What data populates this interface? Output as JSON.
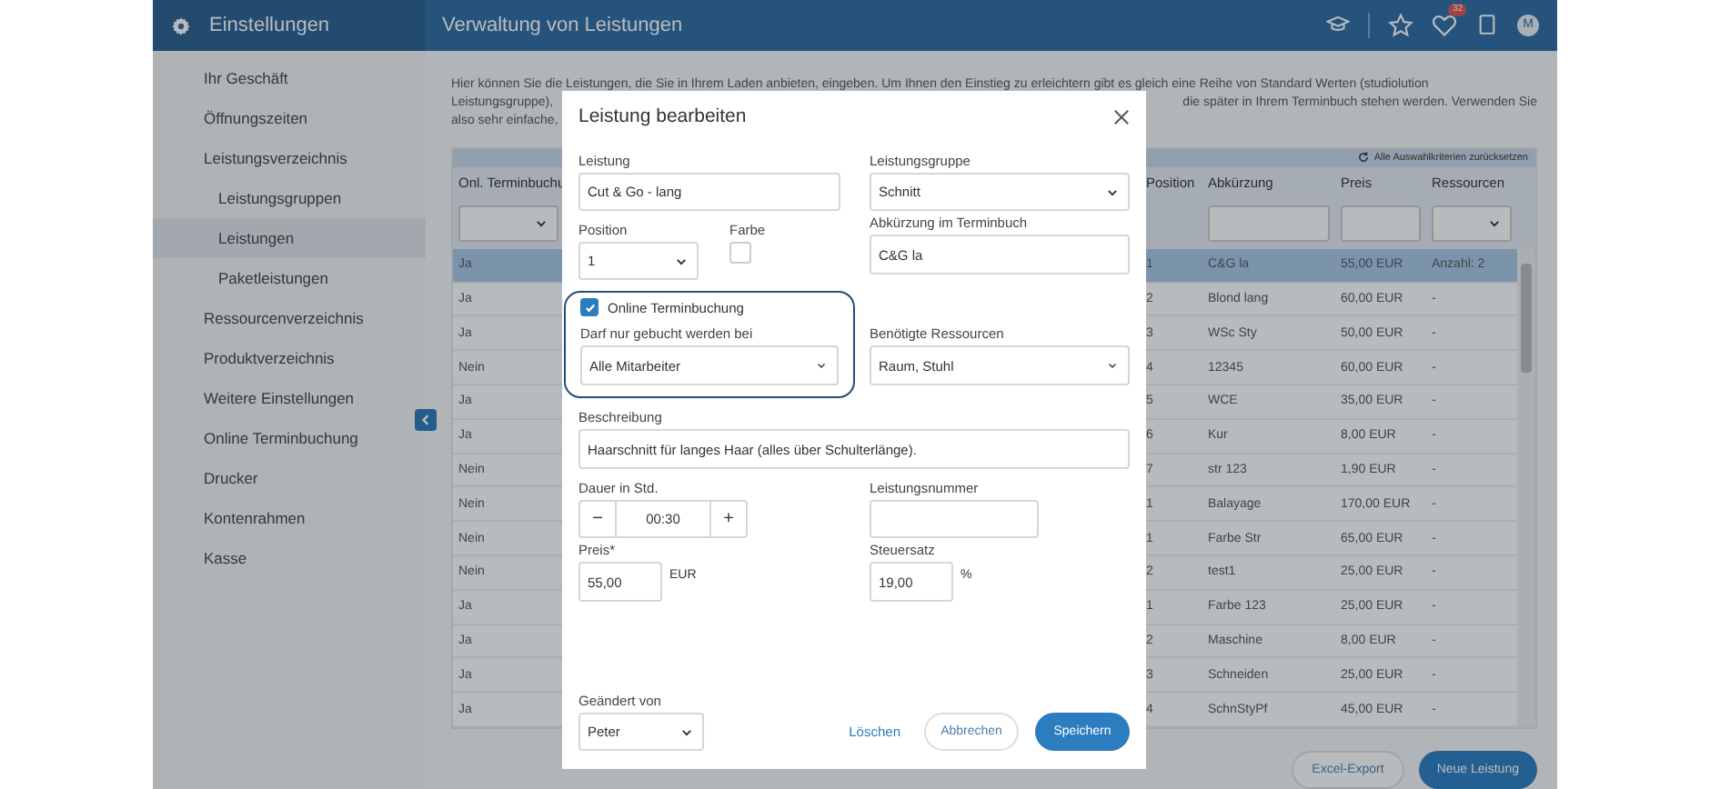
{
  "sidebar": {
    "title": "Einstellungen",
    "items": [
      {
        "label": "Ihr Geschäft",
        "selected": false
      },
      {
        "label": "Öffnungszeiten",
        "selected": false
      },
      {
        "label": "Leistungsverzeichnis",
        "selected": false,
        "children": [
          {
            "label": "Leistungsgruppen",
            "selected": false
          },
          {
            "label": "Leistungen",
            "selected": true
          },
          {
            "label": "Paketleistungen",
            "selected": false
          }
        ]
      },
      {
        "label": "Ressourcenverzeichnis",
        "selected": false
      },
      {
        "label": "Produktverzeichnis",
        "selected": false
      },
      {
        "label": "Weitere Einstellungen",
        "selected": false
      },
      {
        "label": "Online Terminbuchung",
        "selected": false
      },
      {
        "label": "Drucker",
        "selected": false
      },
      {
        "label": "Kontenrahmen",
        "selected": false
      },
      {
        "label": "Kasse",
        "selected": false
      }
    ]
  },
  "header": {
    "title": "Verwaltung von Leistungen",
    "notification_count": "32",
    "avatar": "M"
  },
  "intro": [
    {
      "left": "Hier können Sie die Leistungen, die Sie in Ihrem Laden anbieten, eingeben. Um Ihnen den Einstieg zu erleichtern gibt es gleich eine Reihe von Standard Werten (studiolution"
    },
    {
      "left": "Leistungsgruppe),",
      "right": "die später in Ihrem Terminbuch stehen werden. Verwenden Sie"
    },
    {
      "left": "also sehr einfache,"
    }
  ],
  "table": {
    "reset_link": "Alle Auswahlkriterien zurücksetzen",
    "columns": [
      {
        "label": "Onl. Terminbuchu",
        "kind": "select"
      },
      {
        "label": "Position"
      },
      {
        "label": "Abkürzung",
        "kind": "input"
      },
      {
        "label": "Preis",
        "kind": "input"
      },
      {
        "label": "Ressourcen",
        "kind": "select"
      }
    ],
    "rows": [
      {
        "cells": [
          "Ja",
          "1",
          "C&G la",
          "55,00 EUR",
          "Anzahl: 2"
        ],
        "selected": true
      },
      {
        "cells": [
          "Ja",
          "2",
          "Blond lang",
          "60,00 EUR",
          "-"
        ],
        "selected": false
      },
      {
        "cells": [
          "Ja",
          "3",
          "WSc Sty",
          "50,00 EUR",
          "-"
        ],
        "selected": false
      },
      {
        "cells": [
          "Nein",
          "4",
          "12345",
          "60,00 EUR",
          "-"
        ],
        "selected": false
      },
      {
        "cells": [
          "Ja",
          "5",
          "WCE",
          "35,00 EUR",
          "-"
        ],
        "selected": false
      },
      {
        "cells": [
          "Ja",
          "6",
          "Kur",
          "8,00 EUR",
          "-"
        ],
        "selected": false
      },
      {
        "cells": [
          "Nein",
          "7",
          "str 123",
          "1,90 EUR",
          "-"
        ],
        "selected": false
      },
      {
        "cells": [
          "Nein",
          "1",
          "Balayage",
          "170,00 EUR",
          "-"
        ],
        "selected": false
      },
      {
        "cells": [
          "Nein",
          "1",
          "Farbe Str",
          "65,00 EUR",
          "-"
        ],
        "selected": false
      },
      {
        "cells": [
          "Nein",
          "2",
          "test1",
          "25,00 EUR",
          "-"
        ],
        "selected": false
      },
      {
        "cells": [
          "Ja",
          "1",
          "Farbe 123",
          "25,00 EUR",
          "-"
        ],
        "selected": false
      },
      {
        "cells": [
          "Ja",
          "2",
          "Maschine",
          "8,00 EUR",
          "-"
        ],
        "selected": false
      },
      {
        "cells": [
          "Ja",
          "3",
          "Schneiden",
          "25,00 EUR",
          "-"
        ],
        "selected": false
      },
      {
        "cells": [
          "Ja",
          "4",
          "SchnStyPf",
          "45,00 EUR",
          "-"
        ],
        "selected": false
      }
    ]
  },
  "buttons": [
    "Excel-Export",
    "Neue Leistung"
  ],
  "modal": {
    "title": "Leistung bearbeiten",
    "name": {
      "label": "Leistung",
      "value": "Cut & Go - lang"
    },
    "group": {
      "label": "Leistungsgruppe",
      "value": "Schnitt"
    },
    "position": {
      "label": "Position",
      "value": "1"
    },
    "color": {
      "label": "Farbe",
      "checked": false
    },
    "abbreviation": {
      "label": "Abkürzung im Terminbuch",
      "value": "C&G la"
    },
    "online": {
      "label": "Online Terminbuchung",
      "checked": true
    },
    "staff": {
      "label": "Darf nur gebucht werden bei",
      "value": "Alle Mitarbeiter"
    },
    "resources": {
      "label": "Benötigte Ressourcen",
      "value": "Raum, Stuhl"
    },
    "description": {
      "label": "Beschreibung",
      "value": "Haarschnitt für langes Haar (alles über Schulterlänge)."
    },
    "duration": {
      "label": "Dauer in Std.",
      "minus": "−",
      "value": "00:30",
      "plus": "+"
    },
    "number": {
      "label": "Leistungsnummer"
    },
    "price": {
      "label": "Preis*",
      "value": "55,00",
      "unit": "EUR"
    },
    "tax": {
      "label": "Steuersatz",
      "value": "19,00",
      "unit": "%"
    },
    "changed_by": {
      "label": "Geändert von",
      "value": "Peter"
    },
    "buttons": {
      "delete": "Löschen",
      "cancel": "Abbrechen",
      "save": "Speichern"
    }
  }
}
